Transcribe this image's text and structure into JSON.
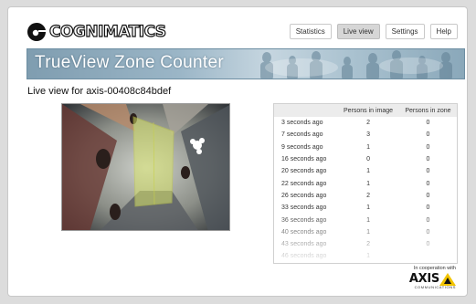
{
  "app": {
    "logo_text": "COGNIMATICS",
    "banner_title": "TrueView Zone Counter",
    "page_title": "Live view for axis-00408c84bdef"
  },
  "nav": [
    {
      "label": "Statistics",
      "active": false
    },
    {
      "label": "Live view",
      "active": true
    },
    {
      "label": "Settings",
      "active": false
    },
    {
      "label": "Help",
      "active": false
    }
  ],
  "table": {
    "headers": [
      "",
      "Persons in image",
      "Persons in zone"
    ],
    "rows": [
      {
        "time": "3 seconds ago",
        "image": "2",
        "zone": "0"
      },
      {
        "time": "7 seconds ago",
        "image": "3",
        "zone": "0"
      },
      {
        "time": "9 seconds ago",
        "image": "1",
        "zone": "0"
      },
      {
        "time": "16 seconds ago",
        "image": "0",
        "zone": "0"
      },
      {
        "time": "20 seconds ago",
        "image": "1",
        "zone": "0"
      },
      {
        "time": "22 seconds ago",
        "image": "1",
        "zone": "0"
      },
      {
        "time": "26 seconds ago",
        "image": "2",
        "zone": "0"
      },
      {
        "time": "33 seconds ago",
        "image": "1",
        "zone": "0"
      },
      {
        "time": "36 seconds ago",
        "image": "1",
        "zone": "0"
      },
      {
        "time": "40 seconds ago",
        "image": "1",
        "zone": "0"
      },
      {
        "time": "43 seconds ago",
        "image": "2",
        "zone": "0"
      },
      {
        "time": "46 seconds ago",
        "image": "1",
        "zone": ""
      }
    ]
  },
  "partner": {
    "label": "In cooperation with",
    "brand": "AXIS",
    "sub": "COMMUNICATIONS"
  },
  "colors": {
    "banner": "#9bb6c7",
    "zone_overlay": "#d7e36a",
    "axis_yellow": "#f2c400"
  }
}
